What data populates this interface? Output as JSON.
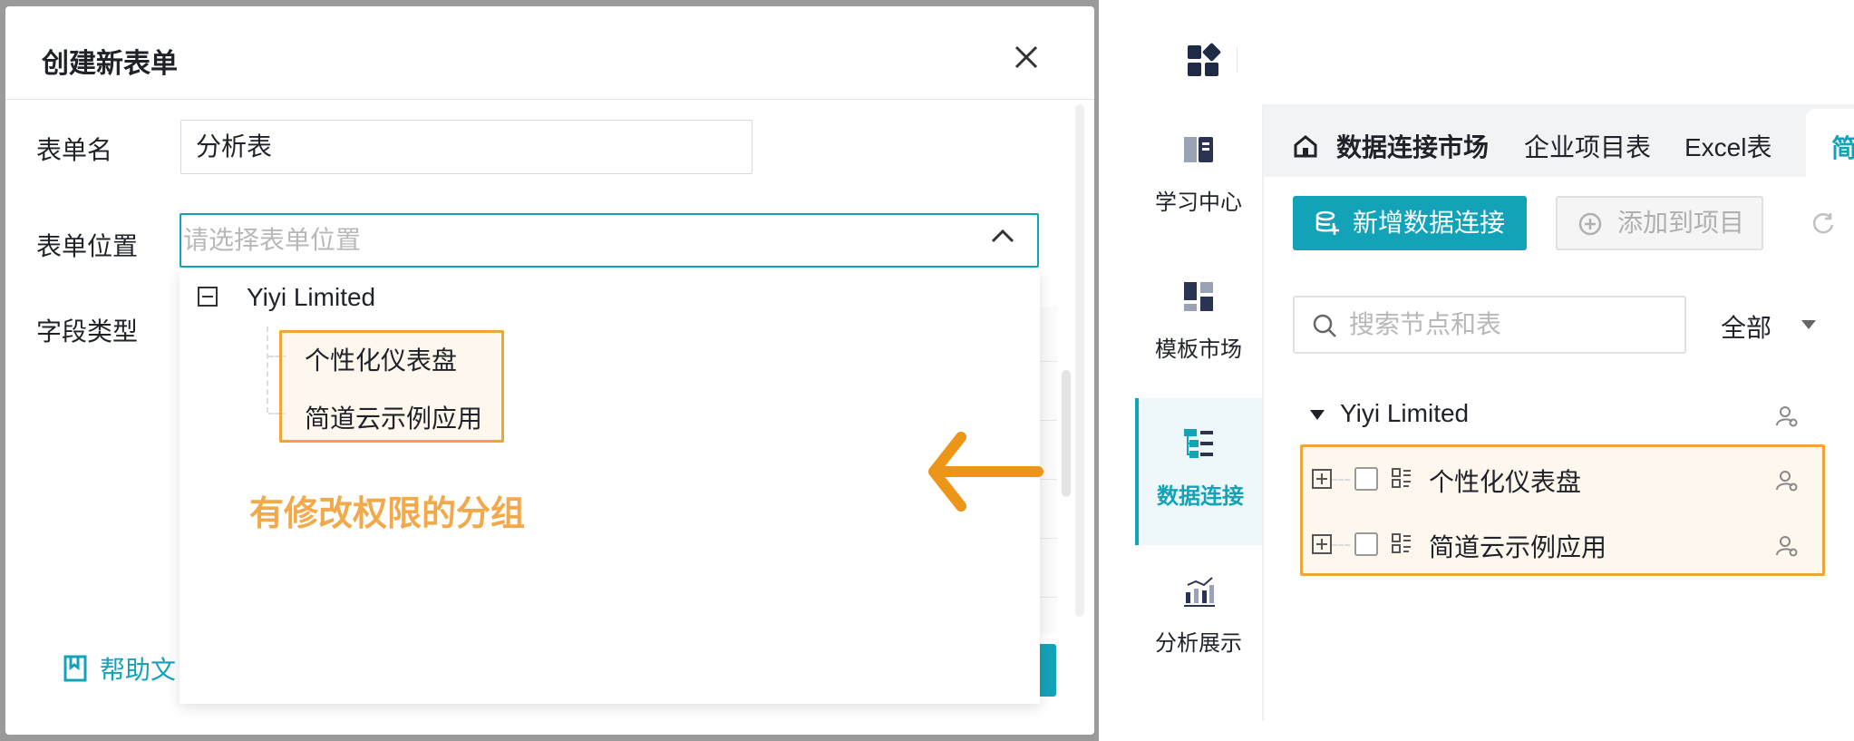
{
  "modal": {
    "title": "创建新表单",
    "fields": {
      "name_label": "表单名",
      "name_value": "分析表",
      "location_label": "表单位置",
      "location_placeholder": "请选择表单位置",
      "fieldtype_label": "字段类型"
    },
    "dropdown": {
      "root": "Yiyi Limited",
      "children": [
        "个性化仪表盘",
        "简道云示例应用"
      ]
    },
    "annotation": "有修改权限的分组",
    "help_link": "帮助文"
  },
  "app": {
    "sidebar": [
      {
        "label": "学习中心",
        "icon": "book-icon"
      },
      {
        "label": "模板市场",
        "icon": "template-icon"
      },
      {
        "label": "数据连接",
        "icon": "data-connect-icon"
      },
      {
        "label": "分析展示",
        "icon": "chart-icon"
      }
    ],
    "tabs": [
      "数据连接市场",
      "企业项目表",
      "Excel表",
      "简"
    ],
    "buttons": {
      "add_connection": "新增数据连接",
      "add_to_project": "添加到项目"
    },
    "search_placeholder": "搜索节点和表",
    "filter": "全部",
    "tree": {
      "root": "Yiyi Limited",
      "items": [
        "个性化仪表盘",
        "简道云示例应用"
      ]
    }
  },
  "colors": {
    "accent": "#13a3b8",
    "highlight": "#f0a43a",
    "annotation": "#f2a94a",
    "arrow": "#ec9519"
  }
}
